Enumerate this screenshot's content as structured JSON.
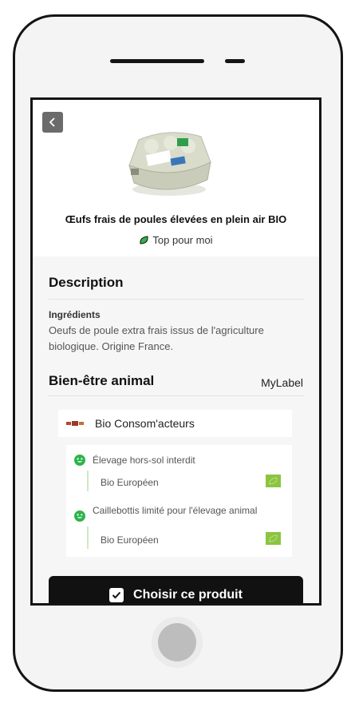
{
  "product": {
    "title": "Œufs frais de poules élevées en plein air BIO",
    "badge": "Top pour moi",
    "image_icon": "egg-carton-image"
  },
  "description": {
    "title": "Description",
    "ingredients_label": "Ingrédients",
    "ingredients_text": "Oeufs de poule extra frais issus de l'agriculture biologique. Origine France."
  },
  "animal_welfare": {
    "title": "Bien-être animal",
    "source": "MyLabel",
    "certification": "Bio Consom'acteurs",
    "criteria": [
      {
        "text": "Élevage hors-sol interdit",
        "label": "Bio Européen"
      },
      {
        "text": "Caillebottis limité pour l'élevage animal",
        "label": "Bio Européen"
      }
    ]
  },
  "cta": {
    "label": "Choisir ce produit"
  },
  "colors": {
    "accent_green": "#2db34a",
    "leaf_green": "#8bc53f",
    "button_bg": "#111111"
  }
}
